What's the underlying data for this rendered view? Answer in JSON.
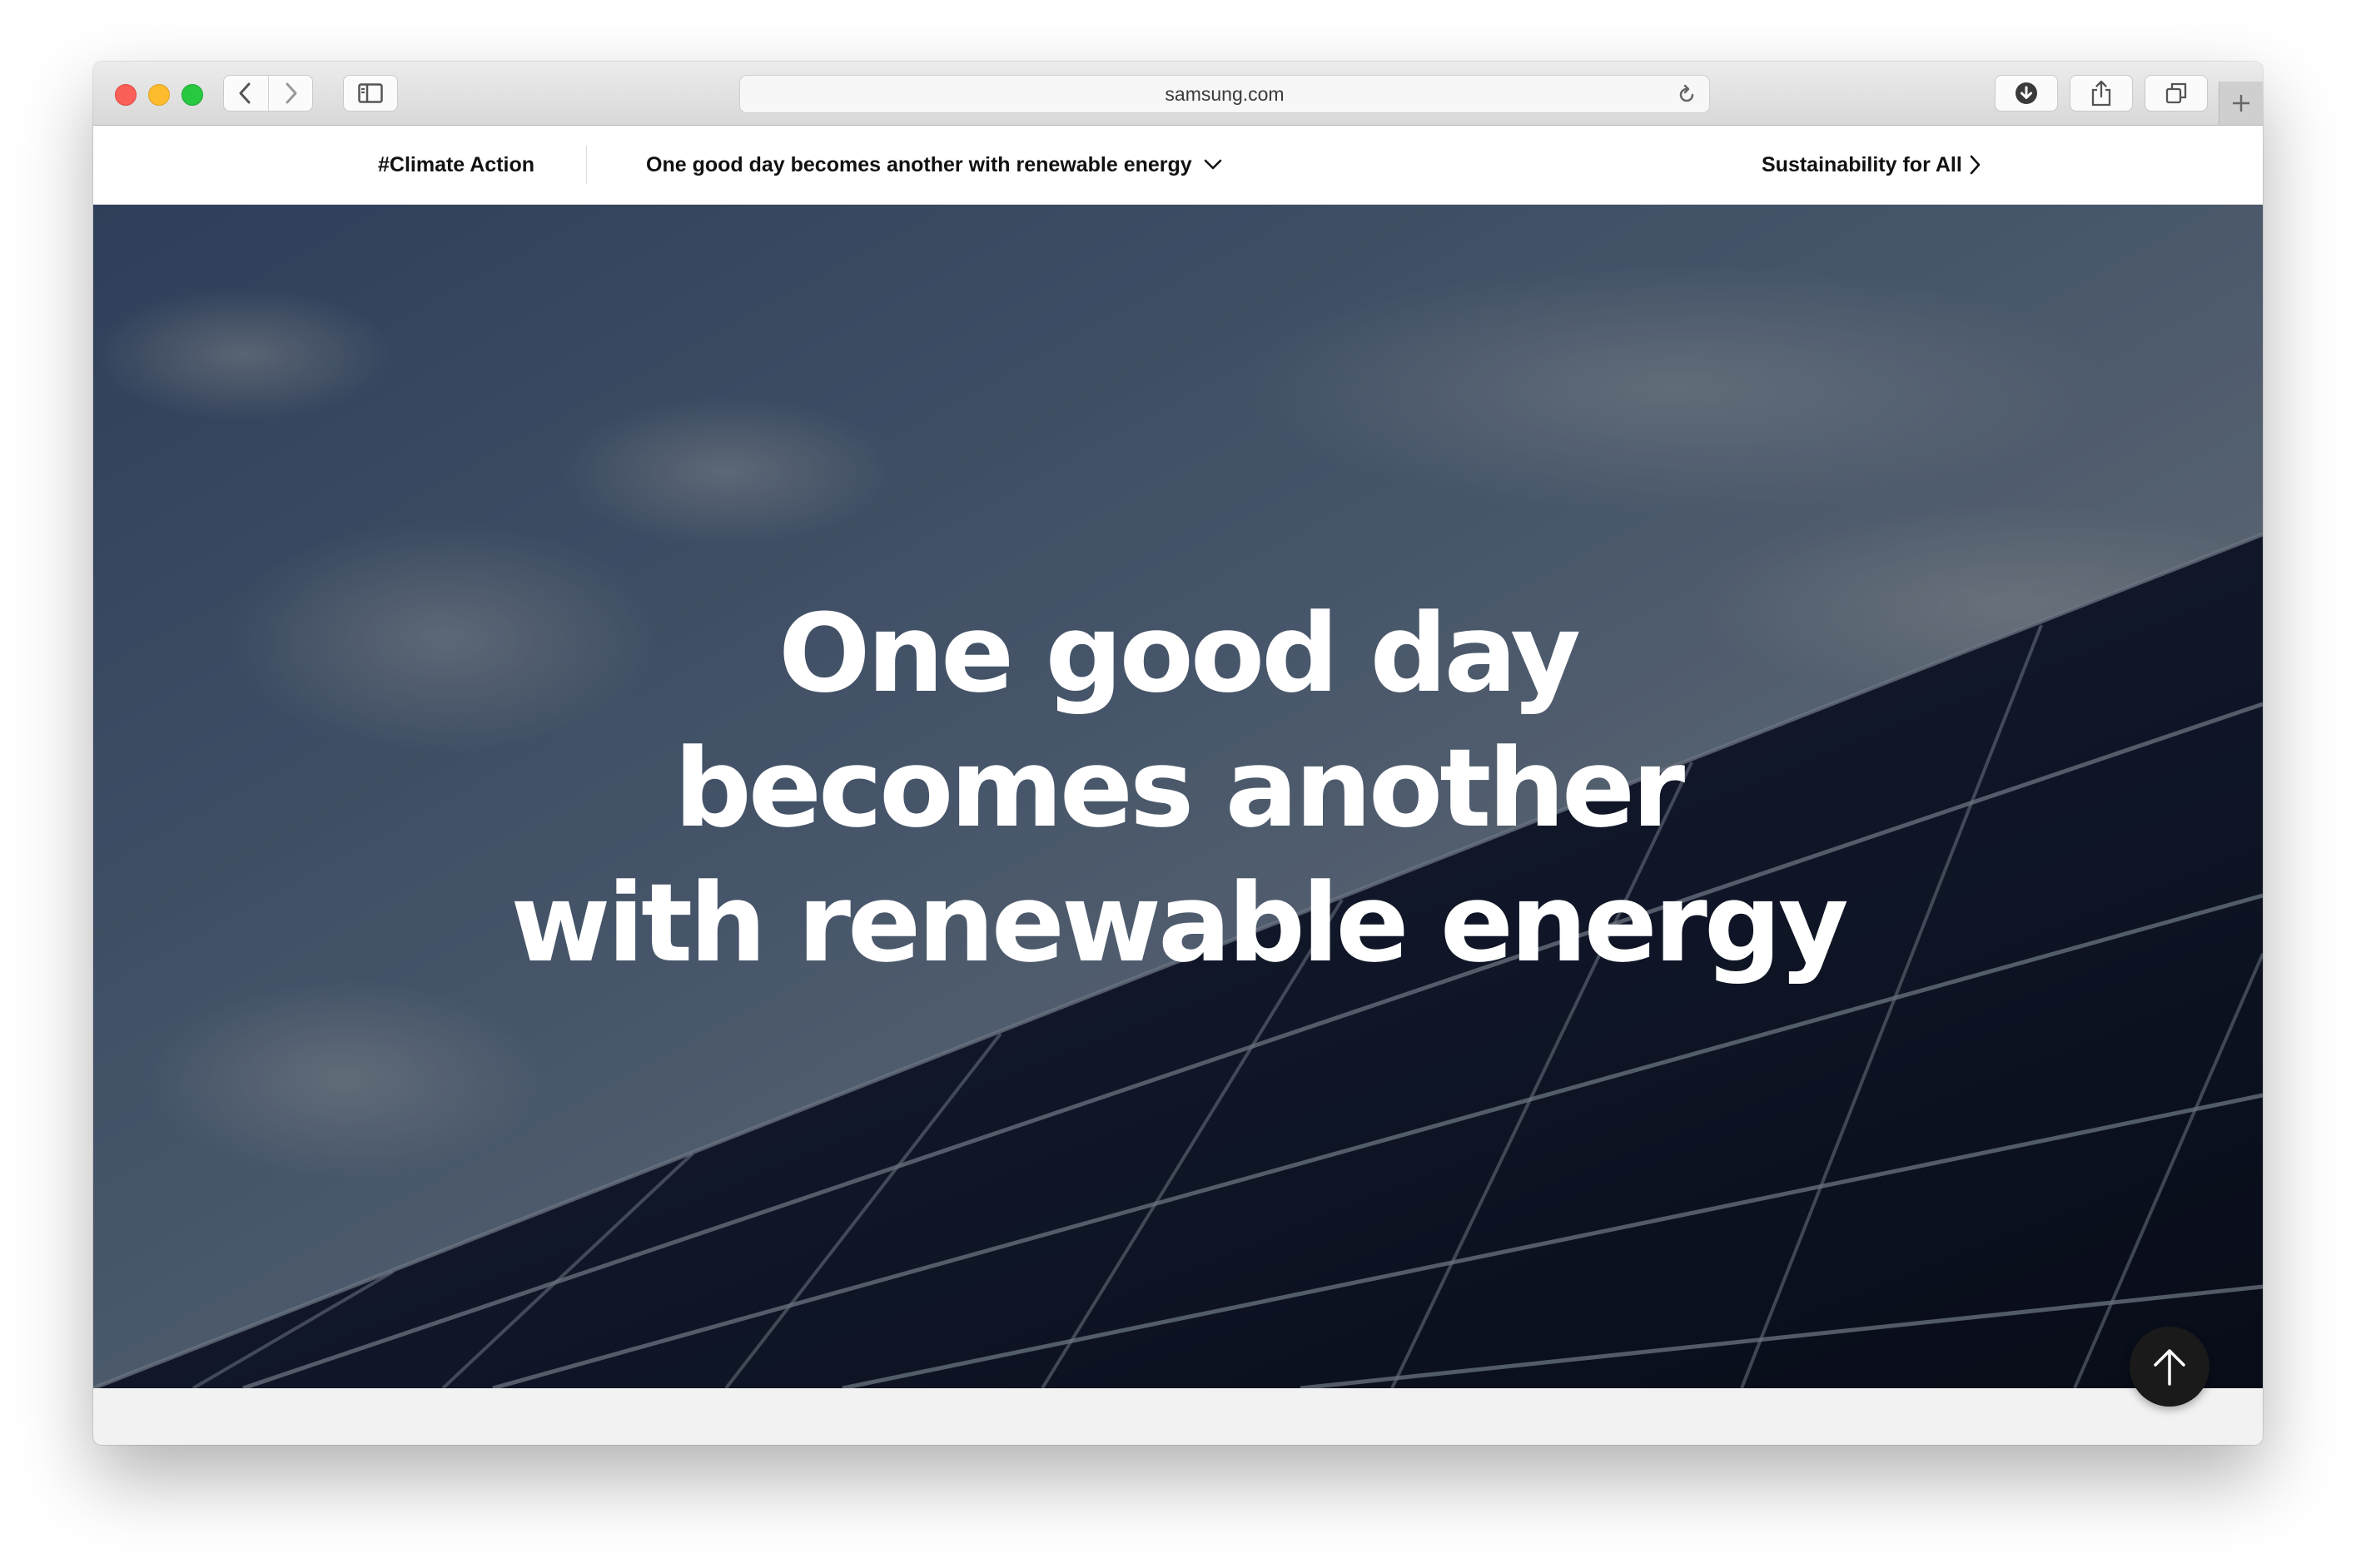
{
  "browser": {
    "url": "samsung.com",
    "icons": {
      "back": "chevron-left-icon",
      "forward": "chevron-right-icon",
      "sidebar": "sidebar-icon",
      "reload": "reload-icon",
      "download": "download-icon",
      "share": "share-icon",
      "tabs": "tabs-icon",
      "new_tab": "plus-icon"
    }
  },
  "nav": {
    "category": "#Climate Action",
    "current_page": "One good day becomes another with renewable energy",
    "next_page": "Sustainability for All"
  },
  "hero": {
    "title_lines": [
      "One good day",
      "becomes another",
      "with renewable energy"
    ]
  },
  "colors": {
    "hero_text": "#ffffff",
    "nav_text": "#111111",
    "top_button": "#1a1a1a"
  }
}
